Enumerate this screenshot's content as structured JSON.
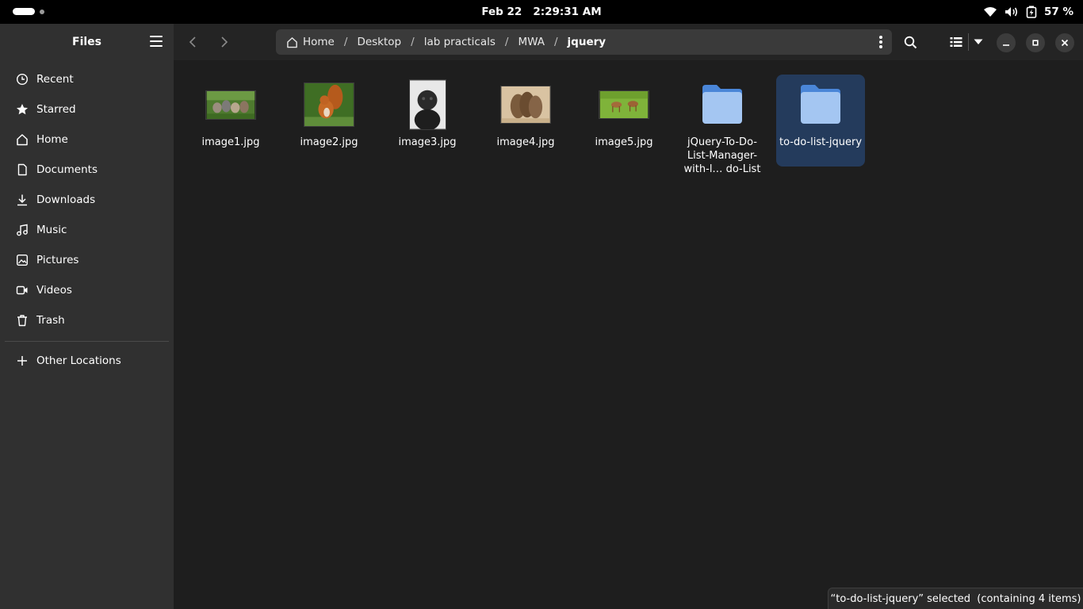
{
  "topbar": {
    "date": "Feb 22",
    "time": "2:29:31 AM",
    "battery": "57 %",
    "icons": [
      "wifi-icon",
      "volume-icon",
      "battery-icon"
    ]
  },
  "sidebar": {
    "title": "Files",
    "items": [
      {
        "label": "Recent",
        "icon": "clock-icon"
      },
      {
        "label": "Starred",
        "icon": "star-icon"
      },
      {
        "label": "Home",
        "icon": "home-icon"
      },
      {
        "label": "Documents",
        "icon": "document-icon"
      },
      {
        "label": "Downloads",
        "icon": "download-icon"
      },
      {
        "label": "Music",
        "icon": "music-icon"
      },
      {
        "label": "Pictures",
        "icon": "picture-icon"
      },
      {
        "label": "Videos",
        "icon": "video-icon"
      },
      {
        "label": "Trash",
        "icon": "trash-icon"
      }
    ],
    "other": {
      "label": "Other Locations",
      "icon": "plus-icon"
    }
  },
  "path": {
    "crumbs": [
      "Home",
      "Desktop",
      "lab practicals",
      "MWA",
      "jquery"
    ]
  },
  "files": [
    {
      "name": "image1.jpg",
      "kind": "image"
    },
    {
      "name": "image2.jpg",
      "kind": "image"
    },
    {
      "name": "image3.jpg",
      "kind": "image"
    },
    {
      "name": "image4.jpg",
      "kind": "image"
    },
    {
      "name": "image5.jpg",
      "kind": "image"
    },
    {
      "name": "jQuery-To-Do-List-Manager-with-l… do-List",
      "kind": "folder"
    },
    {
      "name": "to-do-list-jquery",
      "kind": "folder",
      "selected": true
    }
  ],
  "status": "“to-do-list-jquery” selected  (containing 4 items)",
  "colors": {
    "sidebar_bg": "#303030",
    "content_bg": "#1e1e1e",
    "selection": "#243b5c",
    "folder": "#a4c6f2"
  }
}
